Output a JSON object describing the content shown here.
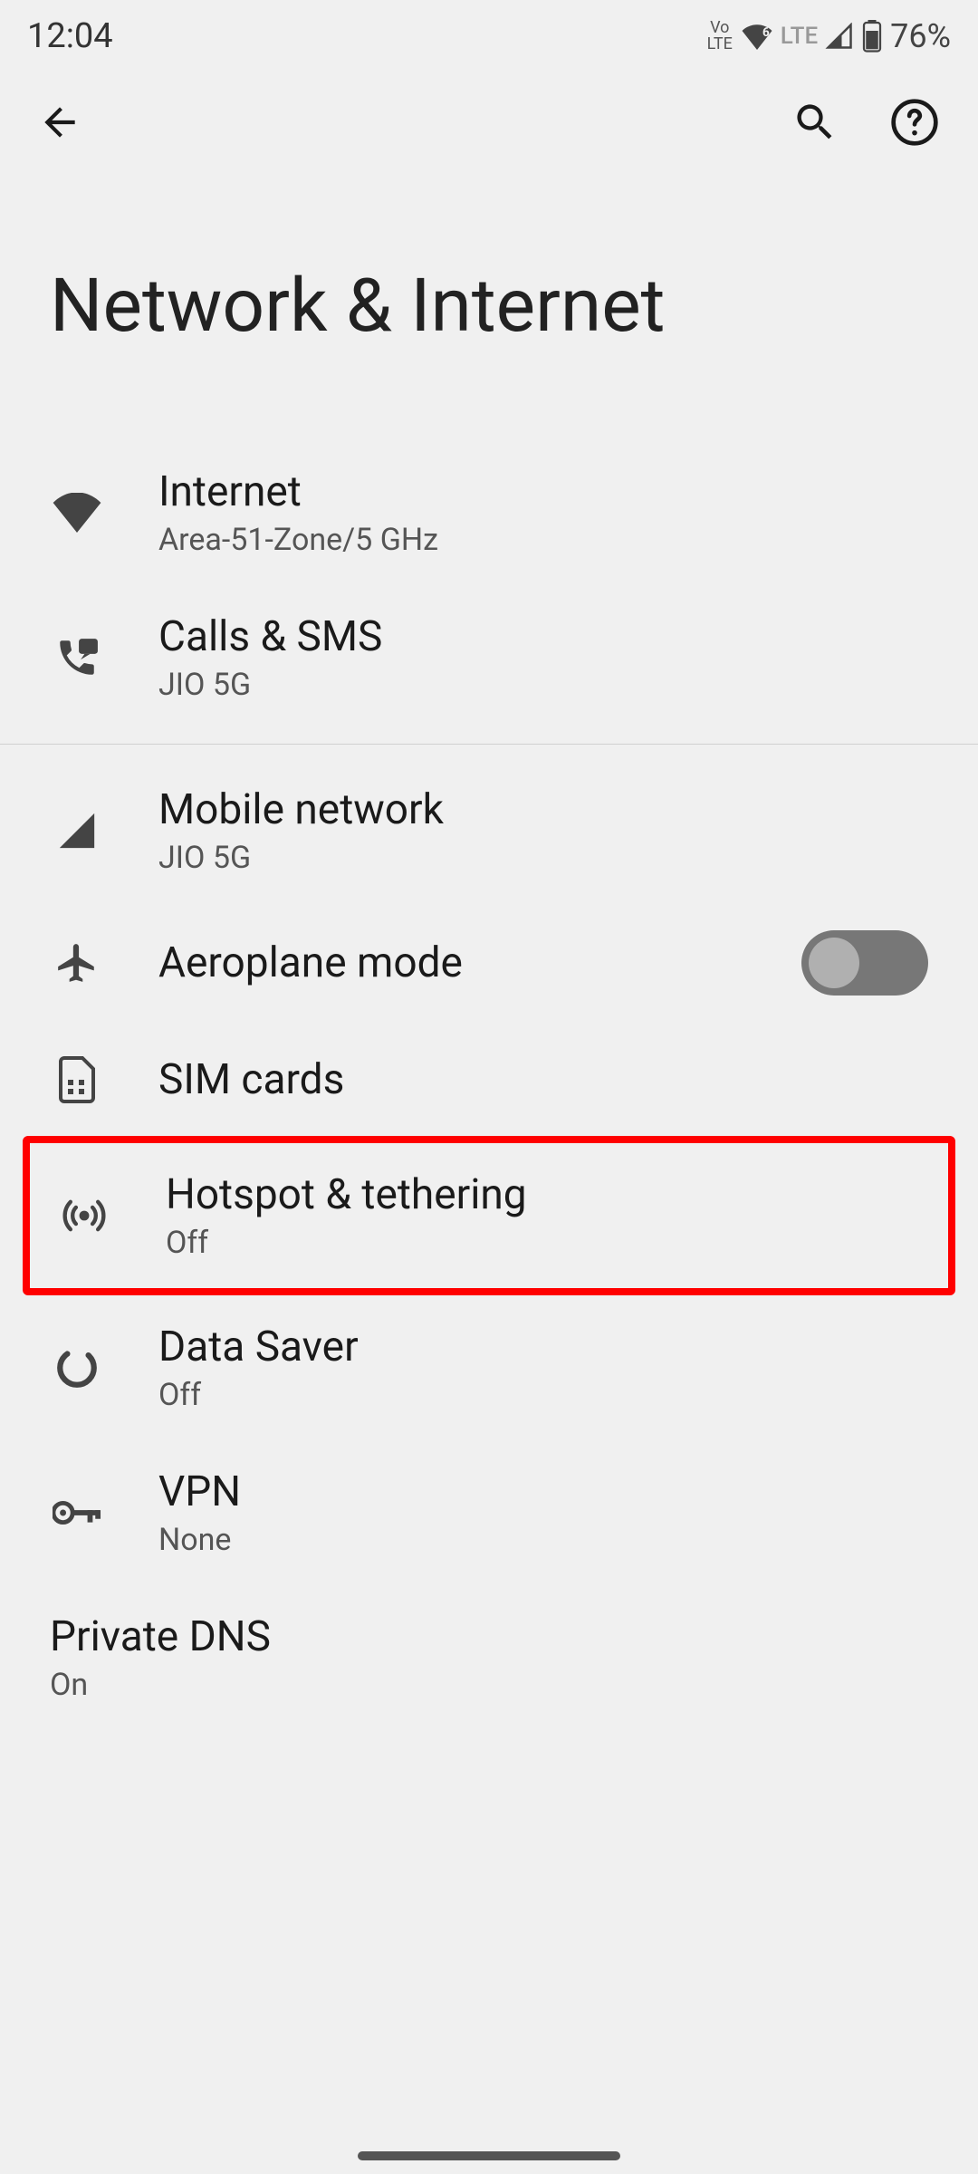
{
  "status": {
    "time": "12:04",
    "volte": "Vo\nLTE",
    "lte": "LTE",
    "battery": "76%"
  },
  "page": {
    "title": "Network & Internet"
  },
  "items": {
    "internet": {
      "title": "Internet",
      "subtitle": "Area-51-Zone/5 GHz"
    },
    "calls": {
      "title": "Calls & SMS",
      "subtitle": "JIO 5G"
    },
    "mobile": {
      "title": "Mobile network",
      "subtitle": "JIO 5G"
    },
    "aeroplane": {
      "title": "Aeroplane mode",
      "toggle": "off"
    },
    "sim": {
      "title": "SIM cards"
    },
    "hotspot": {
      "title": "Hotspot & tethering",
      "subtitle": "Off"
    },
    "datasaver": {
      "title": "Data Saver",
      "subtitle": "Off"
    },
    "vpn": {
      "title": "VPN",
      "subtitle": "None"
    },
    "dns": {
      "title": "Private DNS",
      "subtitle": "On"
    }
  }
}
